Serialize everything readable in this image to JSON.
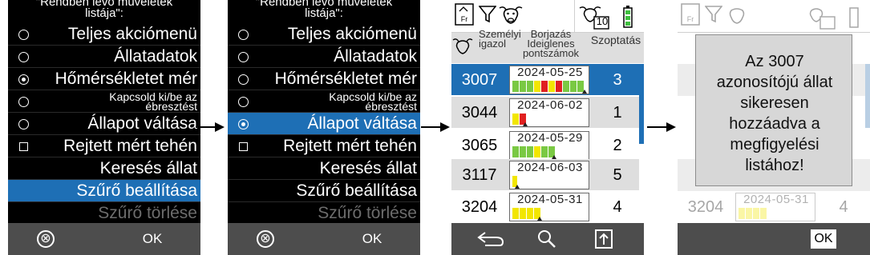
{
  "menu": {
    "header_line1": "\"Rendben lévő műveletek",
    "header_line2": "listája\":",
    "items": [
      {
        "label": "Teljes akciómenü",
        "control": "radio"
      },
      {
        "label": "Állatadatok",
        "control": "radio"
      },
      {
        "label": "Hőmérsékletet mér",
        "control": "radio"
      },
      {
        "label": "Kapcsold ki/be az ébresztést",
        "control": "radio"
      },
      {
        "label": "Állapot váltása",
        "control": "radio"
      },
      {
        "label": "Rejtett mért tehén",
        "control": "checkbox"
      },
      {
        "label": "Keresés állat",
        "control": "none"
      },
      {
        "label": "Szűrő beállítása",
        "control": "none"
      },
      {
        "label": "Szűrő törlése",
        "control": "none"
      }
    ],
    "footer": {
      "cancel_symbol": "⊗",
      "ok_label": "OK"
    }
  },
  "list": {
    "top_icons": [
      "heat-event-icon",
      "filter-icon",
      "cow-icon",
      "cow-count-icon",
      "battery-icon"
    ],
    "cow_count_badge": "10",
    "columns": {
      "id_header": "Személyi igazol",
      "activity_header": "Borjazás Ideiglenes pontszámok",
      "lactation_header": "Szoptatás"
    },
    "rows": [
      {
        "id": "3007",
        "date": "2024-05-25",
        "lactation": "3",
        "selected": true
      },
      {
        "id": "3044",
        "date": "2024-06-02",
        "lactation": "1",
        "selected": false
      },
      {
        "id": "3065",
        "date": "2024-05-29",
        "lactation": "2",
        "selected": false
      },
      {
        "id": "3117",
        "date": "2024-06-03",
        "lactation": "5",
        "selected": false
      },
      {
        "id": "3204",
        "date": "2024-05-31",
        "lactation": "4",
        "selected": false
      }
    ],
    "footer_icons": [
      "back-arrow-icon",
      "search-icon",
      "export-icon"
    ]
  },
  "dialog": {
    "message_lines": [
      "Az 3007",
      "azonosítójú állat",
      "sikeresen",
      "hozzáadva a",
      "megfigyelési",
      "listához!"
    ],
    "ok_label": "OK",
    "background_row": {
      "id": "3204",
      "date": "2024-05-31",
      "lactation": "4"
    }
  },
  "colors": {
    "selection_blue": "#1e6fb5",
    "row_alt_gray": "#dedede",
    "footer_gray": "#4d4d4d",
    "bar_green": "#7ac943",
    "bar_yellow": "#f2e600",
    "bar_red": "#e02020"
  }
}
